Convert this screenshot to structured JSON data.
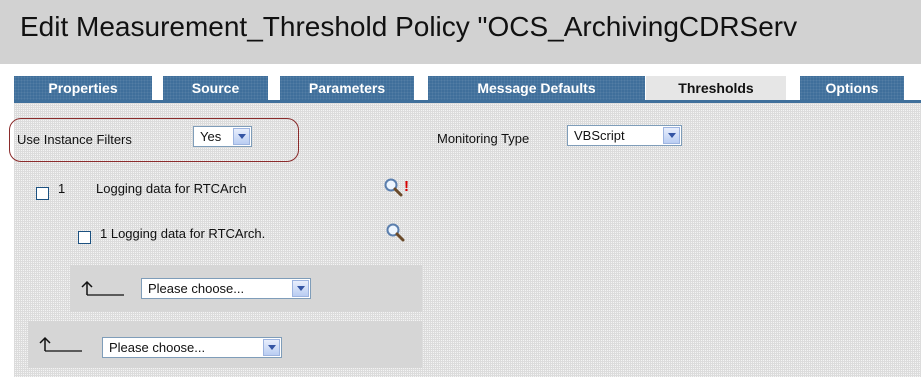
{
  "title": "Edit Measurement_Threshold Policy \"OCS_ArchivingCDRServ",
  "tabs": [
    {
      "label": "Properties"
    },
    {
      "label": "Source"
    },
    {
      "label": "Parameters"
    },
    {
      "label": "Message Defaults"
    },
    {
      "label": "Thresholds",
      "active": true
    },
    {
      "label": "Options"
    }
  ],
  "filters": {
    "use_instance_label": "Use Instance Filters",
    "use_instance_value": "Yes",
    "monitoring_type_label": "Monitoring Type",
    "monitoring_type_value": "VBScript"
  },
  "rows": [
    {
      "number": "1",
      "text": "Logging data for RTCArch",
      "error_mark": "!"
    },
    {
      "text": "1 Logging data for RTCArch."
    }
  ],
  "choosers": [
    {
      "value": "Please choose..."
    },
    {
      "value": "Please choose..."
    }
  ],
  "colors": {
    "tab_bg": "#3f6f9b",
    "active_tab_bg": "#e6e6e6",
    "highlight_oval": "#8a2b2b",
    "error": "#d40000"
  }
}
